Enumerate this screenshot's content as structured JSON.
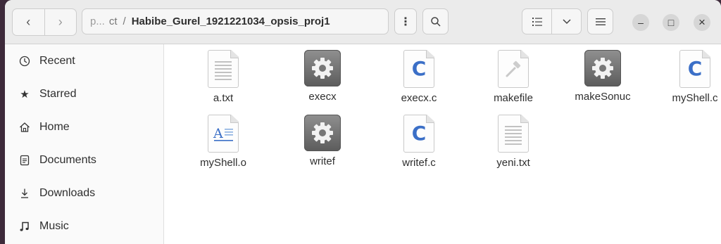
{
  "window": {
    "path": {
      "faded": "p...",
      "mid": "ct",
      "separator": "/",
      "current": "Habibe_Gurel_1921221034_opsis_proj1"
    },
    "buttons": {
      "menu": "⋮",
      "minimize": "–",
      "maximize": "□",
      "close": "×"
    }
  },
  "sidebar": {
    "items": [
      {
        "label": "Recent",
        "icon": "clock-icon"
      },
      {
        "label": "Starred",
        "icon": "star-icon"
      },
      {
        "label": "Home",
        "icon": "home-icon"
      },
      {
        "label": "Documents",
        "icon": "document-icon"
      },
      {
        "label": "Downloads",
        "icon": "download-icon"
      },
      {
        "label": "Music",
        "icon": "music-icon"
      }
    ]
  },
  "files": [
    {
      "name": "a.txt",
      "type": "text"
    },
    {
      "name": "execx",
      "type": "executable"
    },
    {
      "name": "execx.c",
      "type": "c-source"
    },
    {
      "name": "makefile",
      "type": "makefile"
    },
    {
      "name": "makeSonuc",
      "type": "executable"
    },
    {
      "name": "myShell.c",
      "type": "c-source"
    },
    {
      "name": "myShell.o",
      "type": "object"
    },
    {
      "name": "writef",
      "type": "executable"
    },
    {
      "name": "writef.c",
      "type": "c-source"
    },
    {
      "name": "yeni.txt",
      "type": "text"
    }
  ],
  "colors": {
    "c_source": "#3b6fc7",
    "headerbar": "#ebebeb",
    "sidebar": "#fafafa"
  }
}
